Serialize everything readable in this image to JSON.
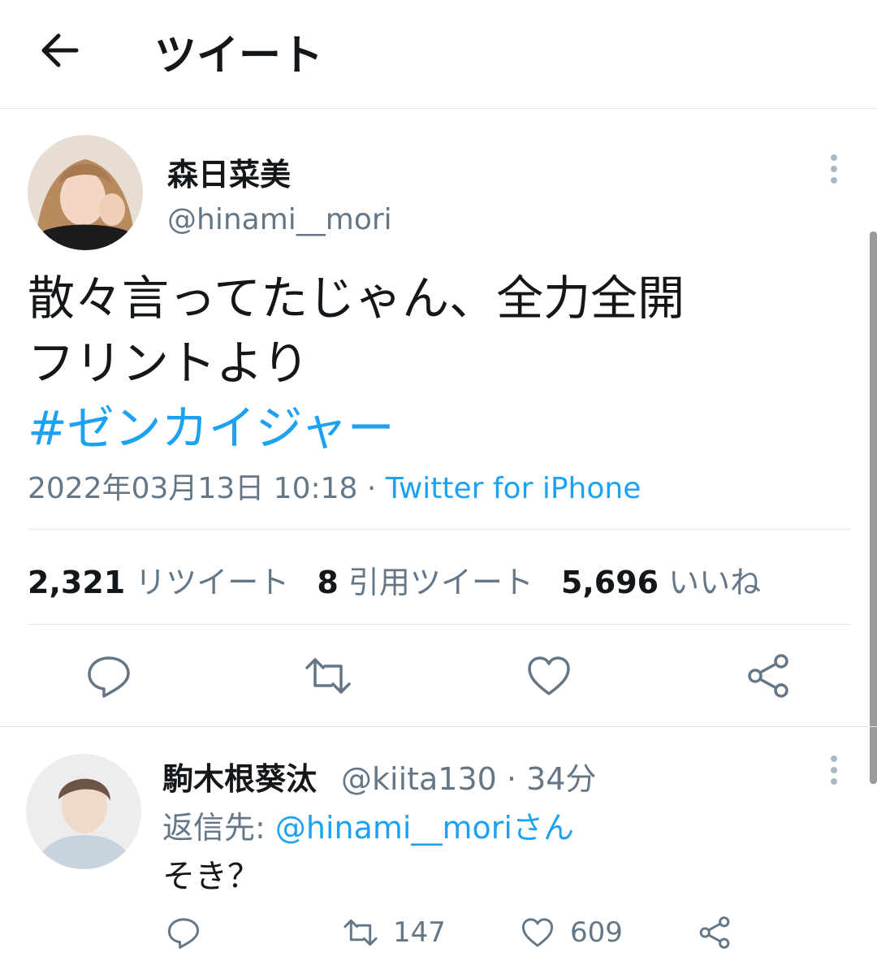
{
  "header": {
    "title": "ツイート",
    "back_icon": "arrow-left-icon"
  },
  "tweet": {
    "author_name": "森日菜美",
    "author_handle": "@hinami__mori",
    "text_lines": [
      "散々言ってたじゃん、全力全開",
      "フリントより"
    ],
    "hashtag": "#ゼンカイジャー",
    "timestamp": "2022年03月13日 10:18",
    "separator": " · ",
    "source": "Twitter for iPhone",
    "stats": {
      "retweets": "2,321",
      "retweets_label": "リツイート",
      "quotes": "8",
      "quotes_label": "引用ツイート",
      "likes": "5,696",
      "likes_label": "いいね"
    }
  },
  "reply": {
    "author_name": "駒木根葵汰",
    "meta": "@kiita130 · 34分",
    "reply_to_prefix": "返信先: ",
    "reply_to_mention": "@hinami__mori",
    "reply_to_suffix": "さん",
    "text": "そき？",
    "retweet_count": "147",
    "like_count": "609"
  },
  "colors": {
    "accent": "#1da1f2",
    "secondary_text": "#657786",
    "primary_text": "#14171a",
    "divider": "#e1e8ed"
  }
}
